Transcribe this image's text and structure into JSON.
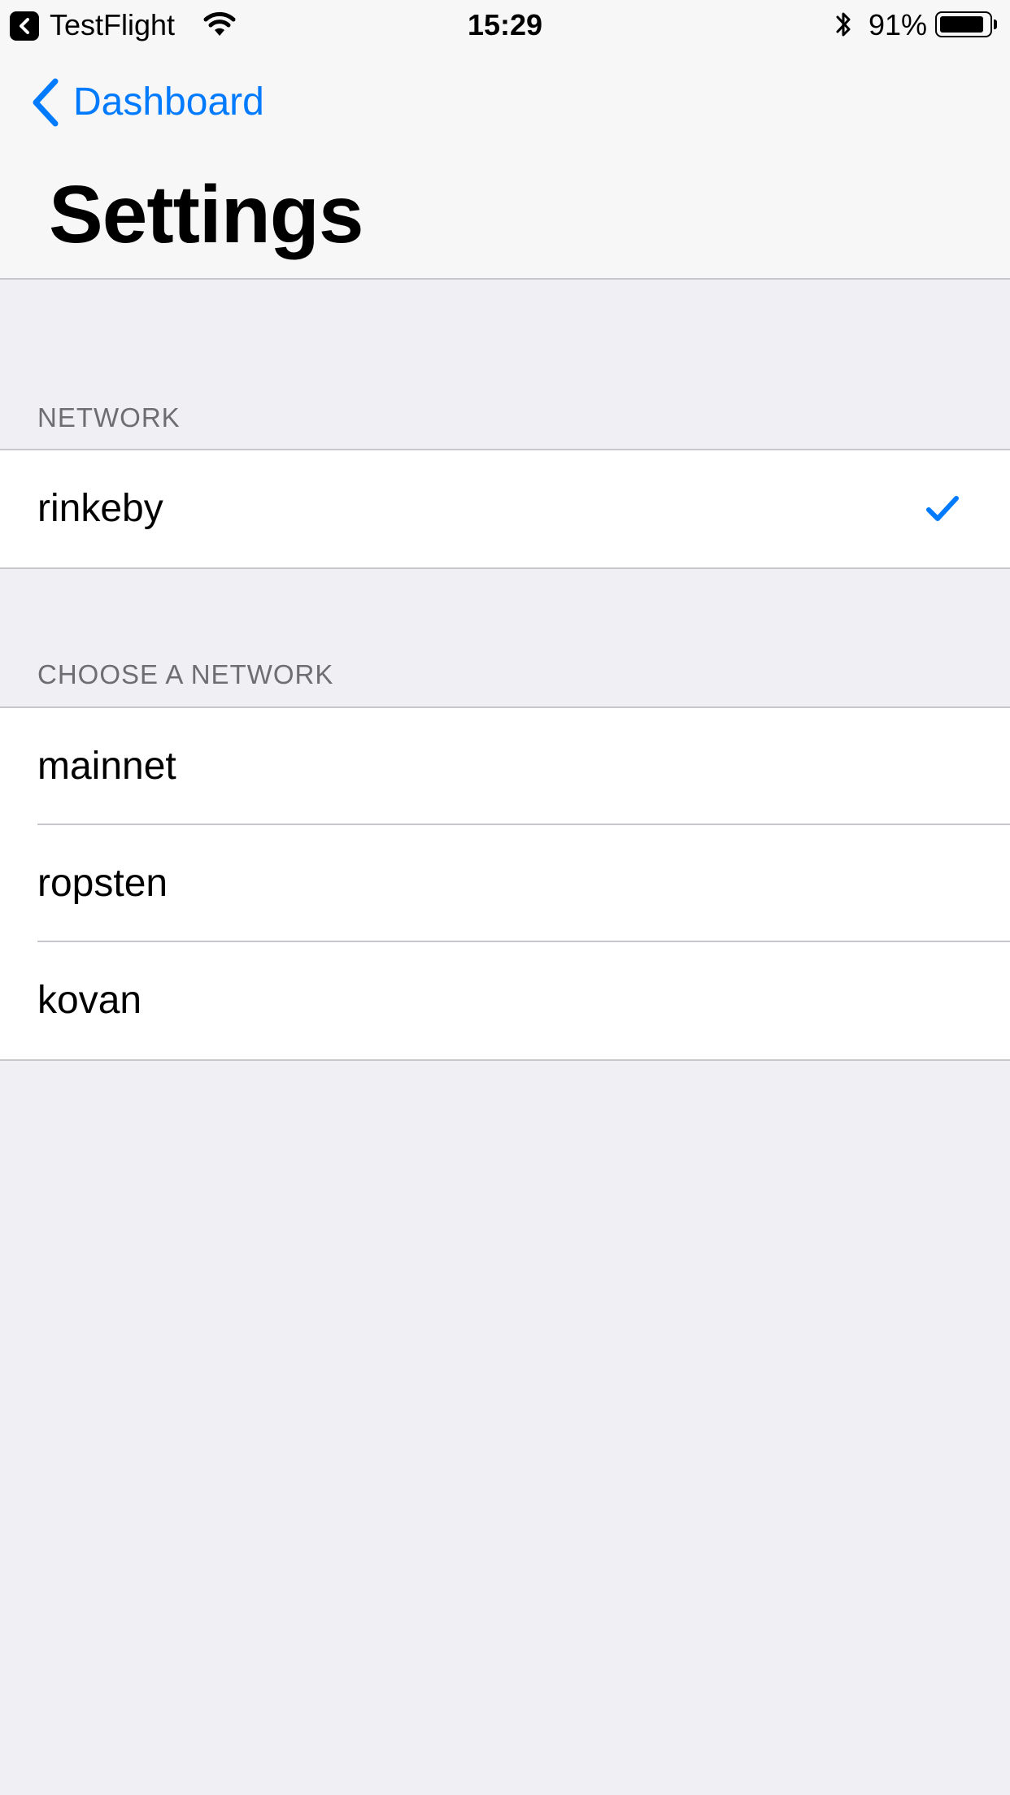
{
  "status_bar": {
    "back_app": "TestFlight",
    "time": "15:29",
    "battery_percent": "91%",
    "battery_level": 0.91,
    "icons": [
      "back-app-icon",
      "wifi-icon",
      "bluetooth-icon",
      "battery-icon"
    ]
  },
  "nav": {
    "back_label": "Dashboard",
    "title": "Settings"
  },
  "sections": {
    "current": {
      "header": "NETWORK",
      "items": [
        {
          "label": "rinkeby",
          "checked": true
        }
      ]
    },
    "choose": {
      "header": "CHOOSE A NETWORK",
      "items": [
        {
          "label": "mainnet"
        },
        {
          "label": "ropsten"
        },
        {
          "label": "kovan"
        }
      ]
    }
  },
  "colors": {
    "accent": "#007aff",
    "background": "#efeff4",
    "separator": "#c8c7cc",
    "section_header": "#6d6d72"
  }
}
